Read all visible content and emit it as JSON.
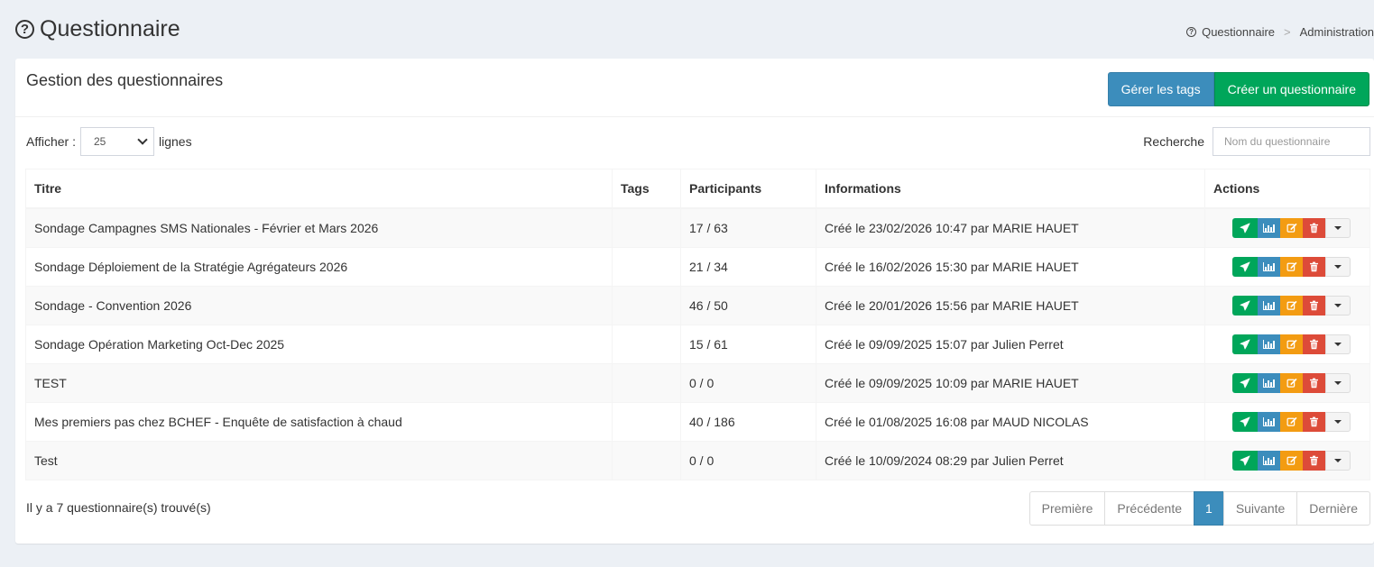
{
  "header": {
    "title": "Questionnaire",
    "breadcrumb": [
      "Questionnaire",
      "Administration"
    ]
  },
  "box": {
    "title": "Gestion des questionnaires",
    "btn_tags": "Gérer les tags",
    "btn_create": "Créer un questionnaire"
  },
  "controls": {
    "show_label": "Afficher :",
    "rows_value": "25",
    "rows_suffix": "lignes",
    "search_label": "Recherche",
    "search_placeholder": "Nom du questionnaire"
  },
  "table": {
    "headers": [
      "Titre",
      "Tags",
      "Participants",
      "Informations",
      "Actions"
    ],
    "rows": [
      {
        "titre": "Sondage Campagnes SMS Nationales - Février et Mars 2026",
        "tags": "",
        "participants": "17 / 63",
        "info": "Créé le 23/02/2026 10:47 par MARIE HAUET"
      },
      {
        "titre": "Sondage Déploiement de la Stratégie Agrégateurs 2026",
        "tags": "",
        "participants": "21 / 34",
        "info": "Créé le 16/02/2026 15:30 par MARIE HAUET"
      },
      {
        "titre": "Sondage - Convention 2026",
        "tags": "",
        "participants": "46 / 50",
        "info": "Créé le 20/01/2026 15:56 par MARIE HAUET"
      },
      {
        "titre": "Sondage Opération Marketing Oct-Dec 2025",
        "tags": "",
        "participants": "15 / 61",
        "info": "Créé le 09/09/2025 15:07 par Julien Perret"
      },
      {
        "titre": "TEST",
        "tags": "",
        "participants": "0 / 0",
        "info": "Créé le 09/09/2025 10:09 par MARIE HAUET"
      },
      {
        "titre": "Mes premiers pas chez BCHEF - Enquête de satisfaction à chaud",
        "tags": "",
        "participants": "40 / 186",
        "info": "Créé le 01/08/2025 16:08 par MAUD NICOLAS"
      },
      {
        "titre": "Test",
        "tags": "",
        "participants": "0 / 0",
        "info": "Créé le 10/09/2024 08:29 par Julien Perret"
      }
    ]
  },
  "footer": {
    "count_text": "Il y a 7 questionnaire(s) trouvé(s)",
    "pagination": {
      "first": "Première",
      "prev": "Précédente",
      "current": "1",
      "next": "Suivante",
      "last": "Dernière"
    }
  },
  "colors": {
    "primary": "#3c8dbc",
    "success": "#00a65a",
    "warning": "#f39c12",
    "danger": "#dd4b39",
    "background": "#ecf0f5"
  },
  "icons": {
    "title": "question-circle-icon",
    "actions": [
      "paper-plane-icon",
      "bar-chart-icon",
      "edit-icon",
      "trash-icon",
      "caret-down-icon"
    ]
  }
}
